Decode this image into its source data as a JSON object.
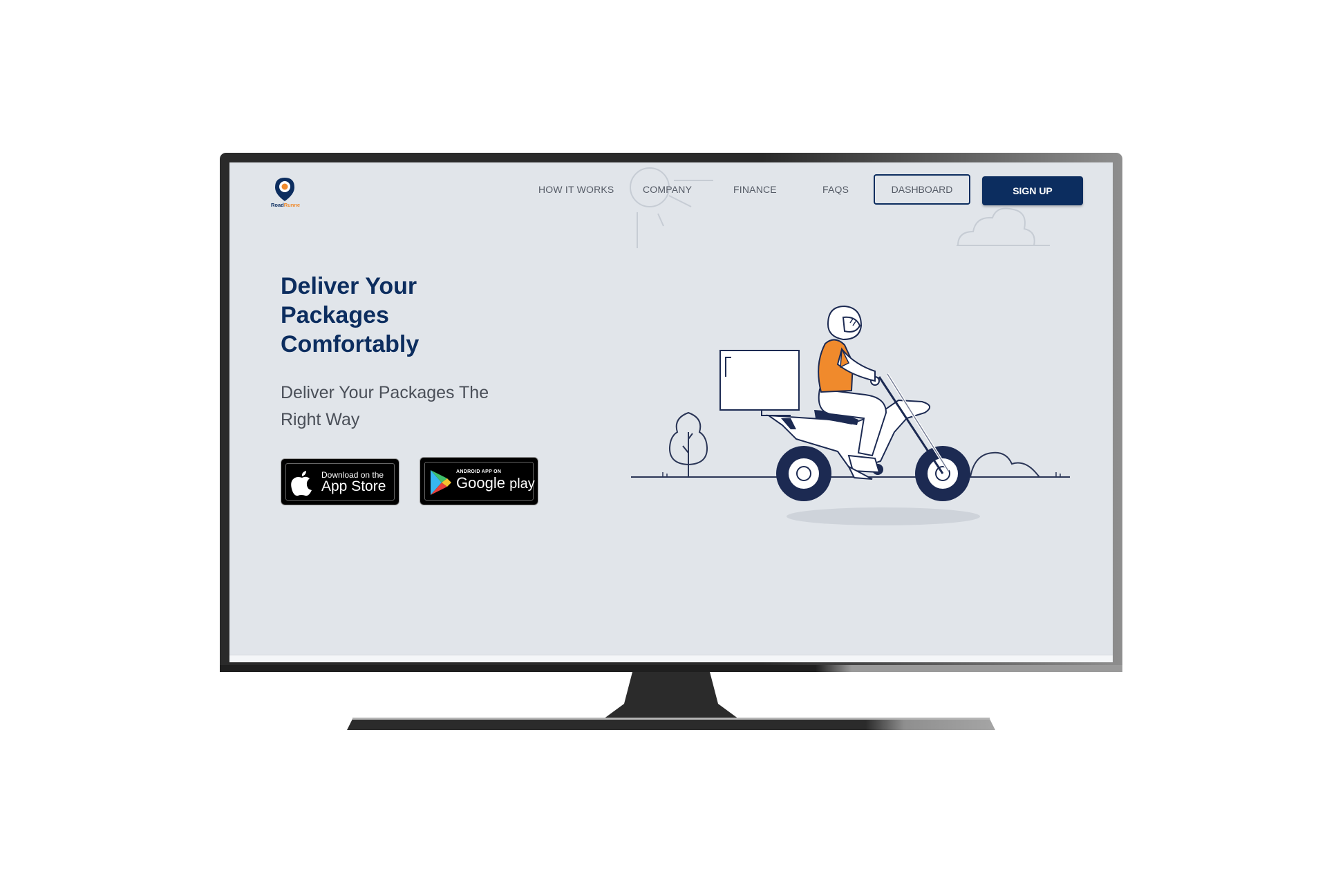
{
  "nav": {
    "items": [
      "HOW IT WORKS",
      "COMPANY",
      "FINANCE",
      "FAQS"
    ],
    "dashboard_label": "DASHBOARD",
    "signup_label": "SIGN UP"
  },
  "logo": {
    "icon": "location-pin-icon",
    "wordmark": "RoadRunner"
  },
  "hero": {
    "title_lines": [
      "Deliver Your",
      "Packages",
      "Comfortably"
    ],
    "subtitle_lines": [
      "Deliver Your Packages The",
      "Right Way"
    ]
  },
  "store_buttons": {
    "appstore": {
      "small": "Download on the",
      "big": "App Store",
      "icon": "apple-icon"
    },
    "googleplay": {
      "small": "ANDROID APP ON",
      "big_a": "Google",
      "big_b": "play",
      "icon": "play-triangle-icon"
    }
  },
  "colors": {
    "brand_navy": "#0c2d5f",
    "accent_orange": "#f08a2c",
    "screen_bg": "#e1e5ea",
    "wheel_navy": "#1c2a52"
  }
}
